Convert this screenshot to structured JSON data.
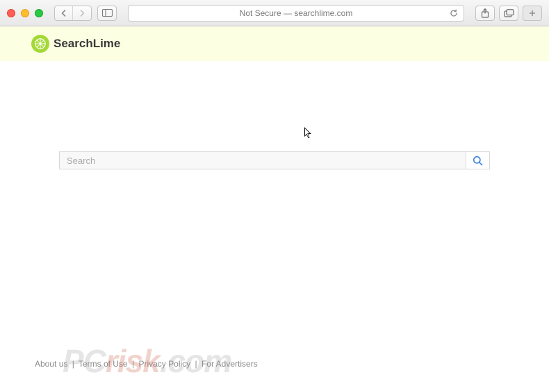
{
  "chrome": {
    "url_display": "Not Secure — searchlime.com"
  },
  "header": {
    "brand_text": "SearchLime"
  },
  "search": {
    "placeholder": "Search",
    "value": ""
  },
  "footer": {
    "links": [
      "About us",
      "Terms of Use",
      "Privacy Policy",
      "For Advertisers"
    ],
    "separator": "|"
  },
  "watermark": {
    "pre": "PC",
    "accent": "risk",
    "post": ".com"
  }
}
